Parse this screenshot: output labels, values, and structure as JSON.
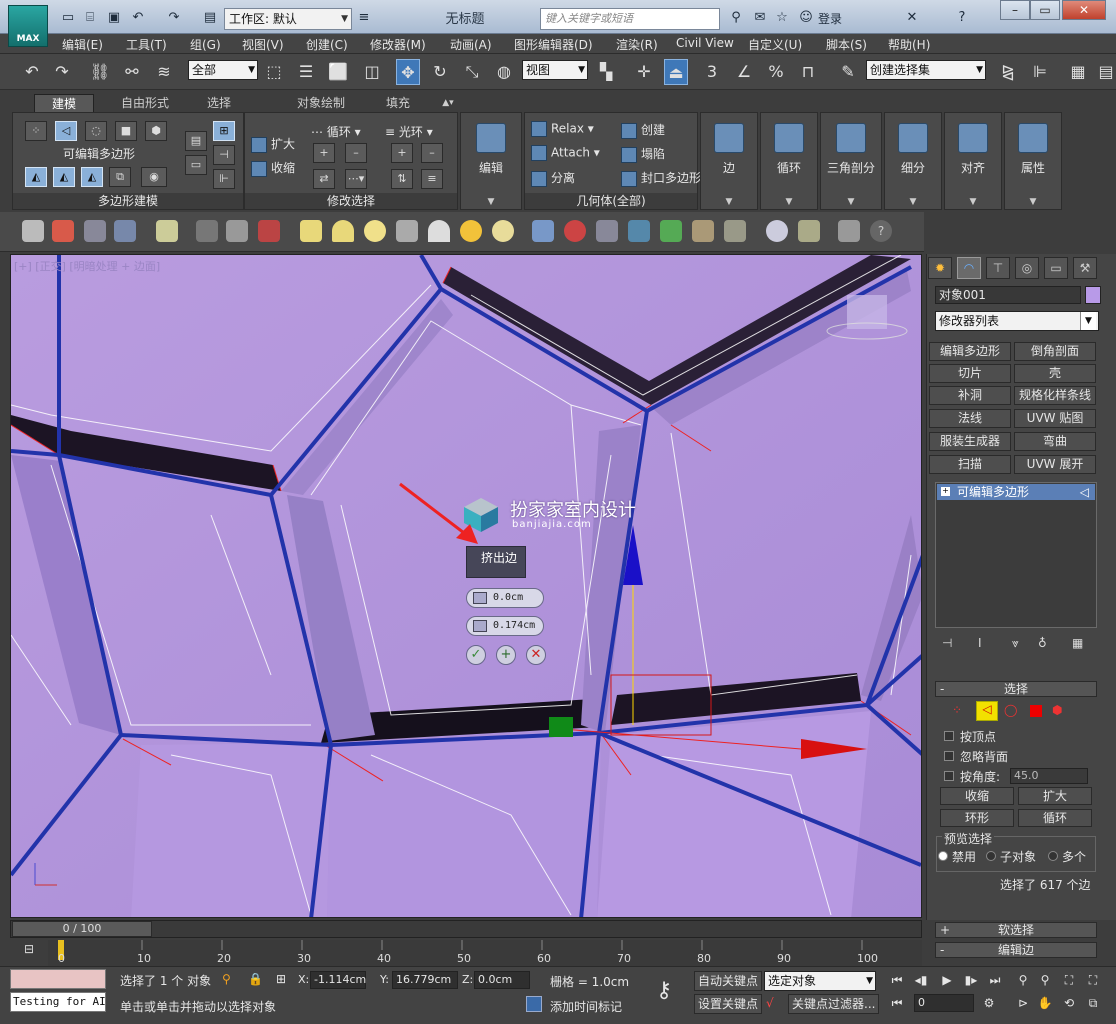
{
  "titlebar": {
    "app_logo": "MAX",
    "workspace_label": "工作区: 默认",
    "doc_title": "无标题",
    "search_placeholder": "键入关键字或短语",
    "login": "登录"
  },
  "menu": [
    "编辑(E)",
    "工具(T)",
    "组(G)",
    "视图(V)",
    "创建(C)",
    "修改器(M)",
    "动画(A)",
    "图形编辑器(D)",
    "渲染(R)",
    "Civil View",
    "自定义(U)",
    "脚本(S)",
    "帮助(H)"
  ],
  "maintoolbar": {
    "filter": "全部",
    "refcoord": "视图",
    "snap3": "3",
    "snap_percent": "%",
    "named_sel": "创建选择集"
  },
  "ribbon": {
    "tabs": [
      "建模",
      "自由形式",
      "选择",
      "对象绘制",
      "填充"
    ],
    "poly_panel": {
      "label": "可编辑多边形",
      "title": "多边形建模"
    },
    "modsel_panel": {
      "title": "修改选择",
      "grow": "扩大",
      "shrink": "收缩",
      "loop": "循环",
      "ring": "光环"
    },
    "edit_btn": "编辑",
    "geom_panel": {
      "title": "几何体(全部)",
      "relax": "Relax",
      "attach": "Attach",
      "detach": "分离",
      "create": "创建",
      "collapse": "塌陷",
      "cap": "封口多边形"
    },
    "big_buttons": [
      "边",
      "循环",
      "三角剖分",
      "细分",
      "对齐",
      "属性"
    ]
  },
  "viewport": {
    "label": "[+] [正交] [明暗处理 + 边面]",
    "watermark": "扮家家室内设计",
    "watermark_sub": "banjiajia.com",
    "caddy": {
      "title": "挤出边",
      "height": "0.0cm",
      "width": "0.174cm"
    }
  },
  "cmdpanel": {
    "object_name": "对象001",
    "modifier_list": "修改器列表",
    "modifier_buttons": [
      "编辑多边形",
      "倒角剖面",
      "切片",
      "壳",
      "补洞",
      "规格化样条线",
      "法线",
      "UVW 贴图",
      "服装生成器",
      "弯曲",
      "扫描",
      "UVW 展开"
    ],
    "stack_item": "可编辑多边形",
    "selection": {
      "title": "选择",
      "by_vertex": "按顶点",
      "ignore_backface": "忽略背面",
      "by_angle": "按角度:",
      "angle_value": "45.0",
      "shrink": "收缩",
      "grow": "扩大",
      "ring": "环形",
      "loop": "循环",
      "preview_title": "预览选择",
      "preview_options": [
        "禁用",
        "子对象",
        "多个"
      ],
      "status": "选择了 617 个边"
    },
    "soft_selection": "软选择",
    "edit_edges": "编辑边"
  },
  "timeline": {
    "frame": "0 / 100",
    "ticks": [
      "0",
      "10",
      "20",
      "30",
      "40",
      "50",
      "60",
      "70",
      "80",
      "90",
      "100"
    ]
  },
  "status": {
    "maxscript": "Testing for AIM",
    "selected": "选择了 1 个 对象",
    "prompt": "单击或单击并拖动以选择对象",
    "x": "-1.114cm",
    "y": "16.779cm",
    "z": "0.0cm",
    "grid": "栅格 = 1.0cm",
    "add_time_tag": "添加时间标记",
    "auto_key": "自动关键点",
    "set_key": "设置关键点",
    "selected_obj": "选定对象",
    "key_filters": "关键点过滤器...",
    "frame_value": "0"
  }
}
